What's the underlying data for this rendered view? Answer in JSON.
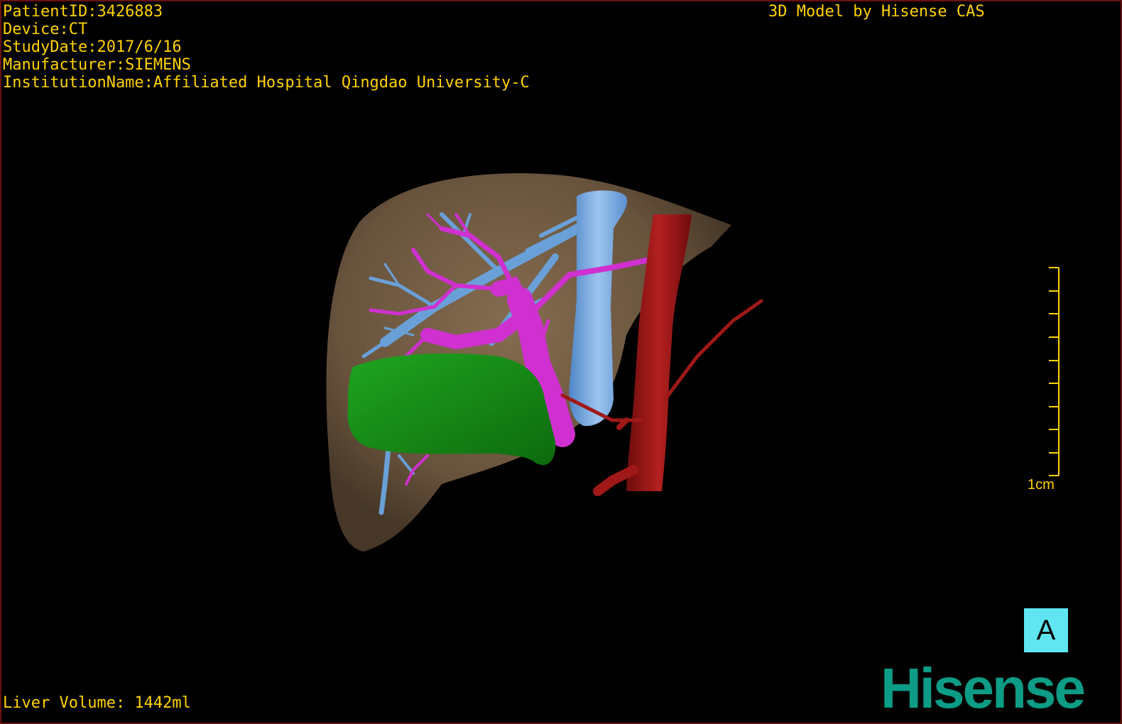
{
  "patient_info": {
    "patient_id": "PatientID:3426883",
    "device": "Device:CT",
    "study_date": "StudyDate:2017/6/16",
    "manufacturer": "Manufacturer:SIEMENS",
    "institution": "InstitutionName:Affiliated Hospital Qingdao University-C"
  },
  "model_credit": "3D Model by Hisense CAS",
  "liver_volume": "Liver Volume: 1442ml",
  "scale_bar": {
    "label": "1cm"
  },
  "orientation_marker": "A",
  "brand_logo": "Hisense",
  "colors": {
    "overlay_text": "#ffd200",
    "liver": "#7a6248",
    "tumor": "#1a8a1a",
    "portal_vein": "#d030d0",
    "hepatic_vein": "#6aa0d8",
    "aorta": "#a01818",
    "orientation_marker_bg": "#5fe6f0",
    "brand": "#0d9c86"
  }
}
